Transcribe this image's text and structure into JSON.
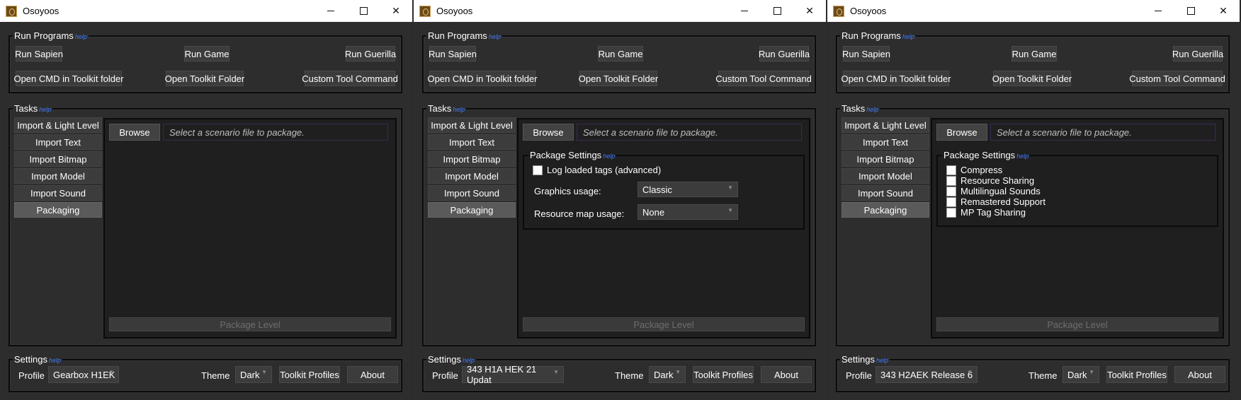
{
  "app_title": "Osoyoos",
  "labels": {
    "run_programs": "Run Programs",
    "tasks": "Tasks",
    "settings": "Settings",
    "help": "help",
    "package_settings": "Package Settings",
    "profile": "Profile",
    "theme": "Theme"
  },
  "run_programs": {
    "run_sapien": "Run Sapien",
    "run_game": "Run Game",
    "run_guerilla": "Run Guerilla",
    "open_cmd": "Open CMD in Toolkit folder",
    "open_toolkit_folder": "Open Toolkit Folder",
    "custom_tool_command": "Custom Tool Command"
  },
  "tasks": [
    "Import & Light Level",
    "Import Text",
    "Import Bitmap",
    "Import Model",
    "Import Sound",
    "Packaging"
  ],
  "browse_label": "Browse",
  "scenario_placeholder": "Select a scenario file to package.",
  "package_level_label": "Package Level",
  "settings": {
    "theme_value": "Dark",
    "toolkit_profiles": "Toolkit Profiles",
    "about": "About"
  },
  "windows": [
    {
      "profile": "Gearbox H1EK"
    },
    {
      "profile": "343 H1A HEK 21 Updat",
      "log_loaded_tags": "Log loaded tags (advanced)",
      "graphics_usage_label": "Graphics usage:",
      "graphics_usage_value": "Classic",
      "resource_map_label": "Resource map usage:",
      "resource_map_value": "None"
    },
    {
      "profile": "343 H2AEK Release 6",
      "options": [
        "Compress",
        "Resource Sharing",
        "Multilingual Sounds",
        "Remastered Support",
        "MP Tag Sharing"
      ]
    }
  ],
  "icons": {
    "minimize": "minimize-icon",
    "maximize": "maximize-icon",
    "close": "close-icon",
    "app": "osoyoos-app-icon",
    "dropdown": "chevron-down-icon"
  }
}
